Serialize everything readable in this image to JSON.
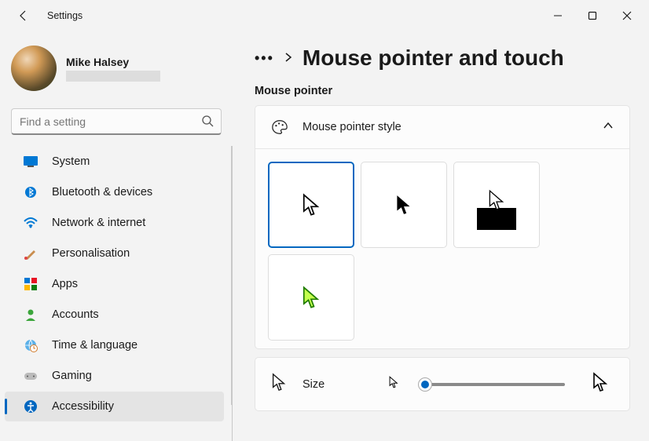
{
  "window": {
    "title": "Settings"
  },
  "user": {
    "name": "Mike Halsey"
  },
  "search": {
    "placeholder": "Find a setting"
  },
  "nav": {
    "items": [
      {
        "label": "System",
        "icon": "system"
      },
      {
        "label": "Bluetooth & devices",
        "icon": "bluetooth"
      },
      {
        "label": "Network & internet",
        "icon": "wifi"
      },
      {
        "label": "Personalisation",
        "icon": "brush"
      },
      {
        "label": "Apps",
        "icon": "apps"
      },
      {
        "label": "Accounts",
        "icon": "account"
      },
      {
        "label": "Time & language",
        "icon": "time"
      },
      {
        "label": "Gaming",
        "icon": "gaming"
      },
      {
        "label": "Accessibility",
        "icon": "accessibility",
        "active": true
      }
    ]
  },
  "page": {
    "title": "Mouse pointer and touch",
    "section_label": "Mouse pointer",
    "style_card_title": "Mouse pointer style",
    "size_label": "Size"
  },
  "pointer_styles": [
    {
      "id": "white",
      "selected": true
    },
    {
      "id": "black",
      "selected": false
    },
    {
      "id": "inverted",
      "selected": false
    },
    {
      "id": "custom",
      "selected": false
    }
  ],
  "colors": {
    "accent": "#0067c0"
  }
}
